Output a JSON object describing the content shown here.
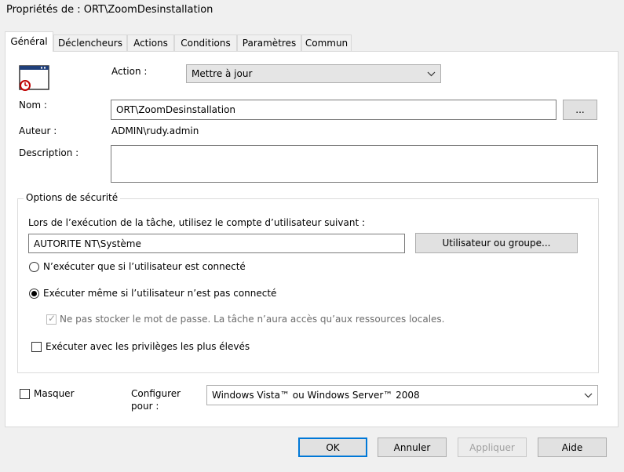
{
  "window": {
    "title": "Propriétés de : ORT\\ZoomDesinstallation"
  },
  "tabs": [
    {
      "label": "Général"
    },
    {
      "label": "Déclencheurs"
    },
    {
      "label": "Actions"
    },
    {
      "label": "Conditions"
    },
    {
      "label": "Paramètres"
    },
    {
      "label": "Commun"
    }
  ],
  "general": {
    "action_label": "Action :",
    "action_value": "Mettre à jour",
    "name_label": "Nom :",
    "name_value": "ORT\\ZoomDesinstallation",
    "browse_label": "...",
    "author_label": "Auteur :",
    "author_value": "ADMIN\\rudy.admin",
    "description_label": "Description :",
    "description_value": ""
  },
  "security": {
    "group_label": "Options de sécurité",
    "account_prompt": "Lors de l’exécution de la tâche, utilisez le compte d’utilisateur suivant :",
    "account_value": "AUTORITE NT\\Système",
    "user_group_button": "Utilisateur ou groupe...",
    "radio_logged_on": "N’exécuter que si l’utilisateur est connecté",
    "radio_whether": "Exécuter même si l’utilisateur n’est pas connecté",
    "no_store_password": "Ne pas stocker le mot de passe. La tâche n’aura accès qu’aux ressources locales.",
    "highest_privileges": "Exécuter avec les privilèges les plus élevés"
  },
  "footer": {
    "hidden_label": "Masquer",
    "configure_label_1": "Configurer",
    "configure_label_2": "pour :",
    "configure_value": "Windows Vista™ ou Windows Server™ 2008"
  },
  "buttons": {
    "ok": "OK",
    "cancel": "Annuler",
    "apply": "Appliquer",
    "help": "Aide"
  },
  "colors": {
    "accent": "#0078d7",
    "panel": "#ffffff",
    "window": "#f0f0f0"
  }
}
